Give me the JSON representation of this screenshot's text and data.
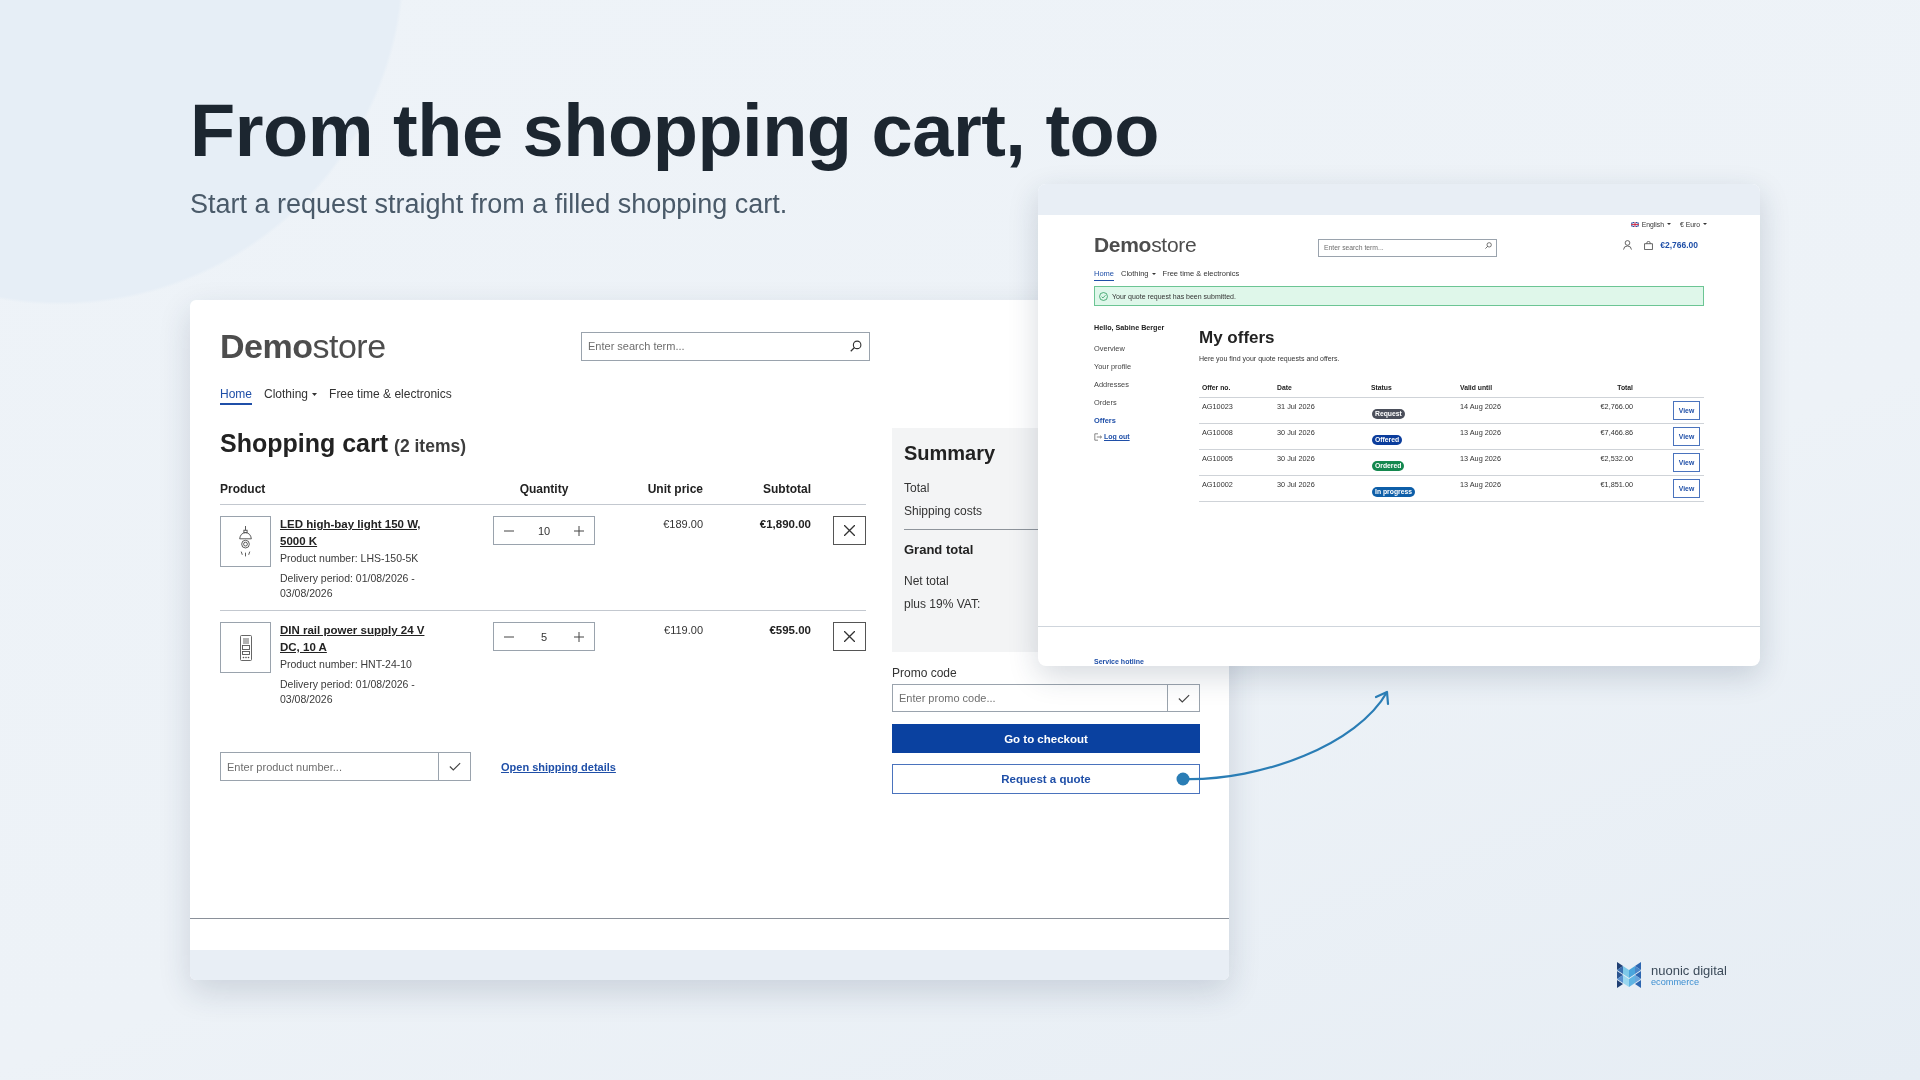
{
  "headline": {
    "title": "From the shopping cart, too",
    "subtitle": "Start a request straight from a filled shopping cart."
  },
  "cart_window": {
    "logo": "**Demo**store",
    "search": {
      "placeholder": "Enter search term..."
    },
    "nav": [
      {
        "label": "Home",
        "selected": true,
        "dropdown": false
      },
      {
        "label": "Clothing",
        "selected": false,
        "dropdown": true
      },
      {
        "label": "Free time & electronics",
        "selected": false,
        "dropdown": false
      }
    ],
    "title": "Shopping cart",
    "item_count": "(2 items)",
    "columns": [
      "Product",
      "Quantity",
      "Unit price",
      "Subtotal"
    ],
    "items": [
      {
        "kind": "lamp",
        "name": "LED high-bay light 150 W, 5000 K",
        "product_number": "Product number: LHS-150-5K",
        "delivery": "Delivery period: 01/08/2026 - 03/08/2026",
        "quantity": "10",
        "unit_price": "€189.00",
        "subtotal": "€1,890.00"
      },
      {
        "kind": "din_module",
        "name": "DIN rail power supply 24 V DC, 10 A",
        "product_number": "Product number: HNT-24-10",
        "delivery": "Delivery period: 01/08/2026 - 03/08/2026",
        "quantity": "5",
        "unit_price": "€119.00",
        "subtotal": "€595.00"
      }
    ],
    "product_number_field": {
      "placeholder": "Enter product number..."
    },
    "shipping_link": "Open shipping details",
    "summary": {
      "title": "Summary",
      "lines": [
        {
          "kind": "plain",
          "label": "Total"
        },
        {
          "kind": "plain",
          "label": "Shipping costs"
        },
        {
          "kind": "heading",
          "label": "Grand total"
        },
        {
          "kind": "plain",
          "label": "Net total"
        },
        {
          "kind": "plain",
          "label": "plus 19% VAT:"
        }
      ]
    },
    "promo": {
      "label": "Promo code",
      "placeholder": "Enter promo code..."
    },
    "buttons": [
      {
        "kind": "primary",
        "label": "Go to checkout"
      },
      {
        "kind": "secondary",
        "label": "Request a quote"
      }
    ]
  },
  "offers_window": {
    "language": "English",
    "currency": "€ Euro",
    "logo": "**Demo**store",
    "search": {
      "placeholder": "Enter search term..."
    },
    "cart_total": "€2,766.00",
    "nav": [
      {
        "label": "Home",
        "selected": true,
        "dropdown": false
      },
      {
        "label": "Clothing",
        "selected": false,
        "dropdown": true
      },
      {
        "label": "Free time & electronics",
        "selected": false,
        "dropdown": false
      }
    ],
    "alert": "Your quote request has been submitted.",
    "greeting": "Hello, Sabine Berger",
    "menu": [
      {
        "label": "Overview",
        "selected": false
      },
      {
        "label": "Your profile",
        "selected": false
      },
      {
        "label": "Addresses",
        "selected": false
      },
      {
        "label": "Orders",
        "selected": false
      },
      {
        "label": "Offers",
        "selected": true
      }
    ],
    "logout": "Log out",
    "title": "My offers",
    "intro": "Here you find your quote requests and offers.",
    "columns": [
      "Offer no.",
      "Date",
      "Status",
      "Valid until",
      "Total"
    ],
    "offers": [
      {
        "offer_no": "AG10023",
        "date": "31 Jul 2026",
        "status": "Request",
        "color": "#4b4f5b",
        "valid_until": "14 Aug 2026",
        "total": "€2,766.00",
        "action": "View"
      },
      {
        "offer_no": "AG10008",
        "date": "30 Jul 2026",
        "status": "Offered",
        "color": "#0b3d9c",
        "valid_until": "13 Aug 2026",
        "total": "€7,466.86",
        "action": "View"
      },
      {
        "offer_no": "AG10005",
        "date": "30 Jul 2026",
        "status": "Ordered",
        "color": "#14884f",
        "valid_until": "13 Aug 2026",
        "total": "€2,532.00",
        "action": "View"
      },
      {
        "offer_no": "AG10002",
        "date": "30 Jul 2026",
        "status": "In progress",
        "color": "#0d5ea8",
        "valid_until": "13 Aug 2026",
        "total": "€1,851.00",
        "action": "View"
      }
    ],
    "footer_link": "Service hotline"
  },
  "brand": {
    "name": "nuonic digital",
    "tagline": "ecommerce"
  }
}
